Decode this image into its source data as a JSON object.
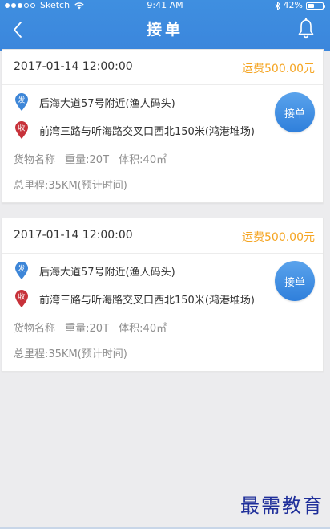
{
  "status_bar": {
    "carrier": "Sketch",
    "time": "9:41 AM",
    "battery": "42%",
    "battery_level": 0.42
  },
  "nav": {
    "title": "接单"
  },
  "orders": [
    {
      "time": "2017-01-14 12:00:00",
      "fee": "运费500.00元",
      "from_tag": "发",
      "from": "后海大道57号附近(渔人码头)",
      "to_tag": "收",
      "to": "前湾三路与听海路交叉口西北150米(鸿港堆场)",
      "goods": "货物名称",
      "weight": "重量:20T",
      "volume": "体积:40㎡",
      "distance": "总里程:35KM(预计时间)",
      "accept": "接单"
    },
    {
      "time": "2017-01-14 12:00:00",
      "fee": "运费500.00元",
      "from_tag": "发",
      "from": "后海大道57号附近(渔人码头)",
      "to_tag": "收",
      "to": "前湾三路与听海路交叉口西北150米(鸿港堆场)",
      "goods": "货物名称",
      "weight": "重量:20T",
      "volume": "体积:40㎡",
      "distance": "总里程:35KM(预计时间)",
      "accept": "接单"
    }
  ],
  "watermark": "最需教育",
  "colors": {
    "header": "#3b86dc",
    "fee": "#f5a523",
    "from_pin": "#3d86d8",
    "to_pin": "#c7323a",
    "accept": "#3b86dc"
  },
  "icons": {
    "back": "chevron-left-icon",
    "bell": "bell-icon",
    "from": "pin-icon",
    "to": "pin-icon"
  }
}
